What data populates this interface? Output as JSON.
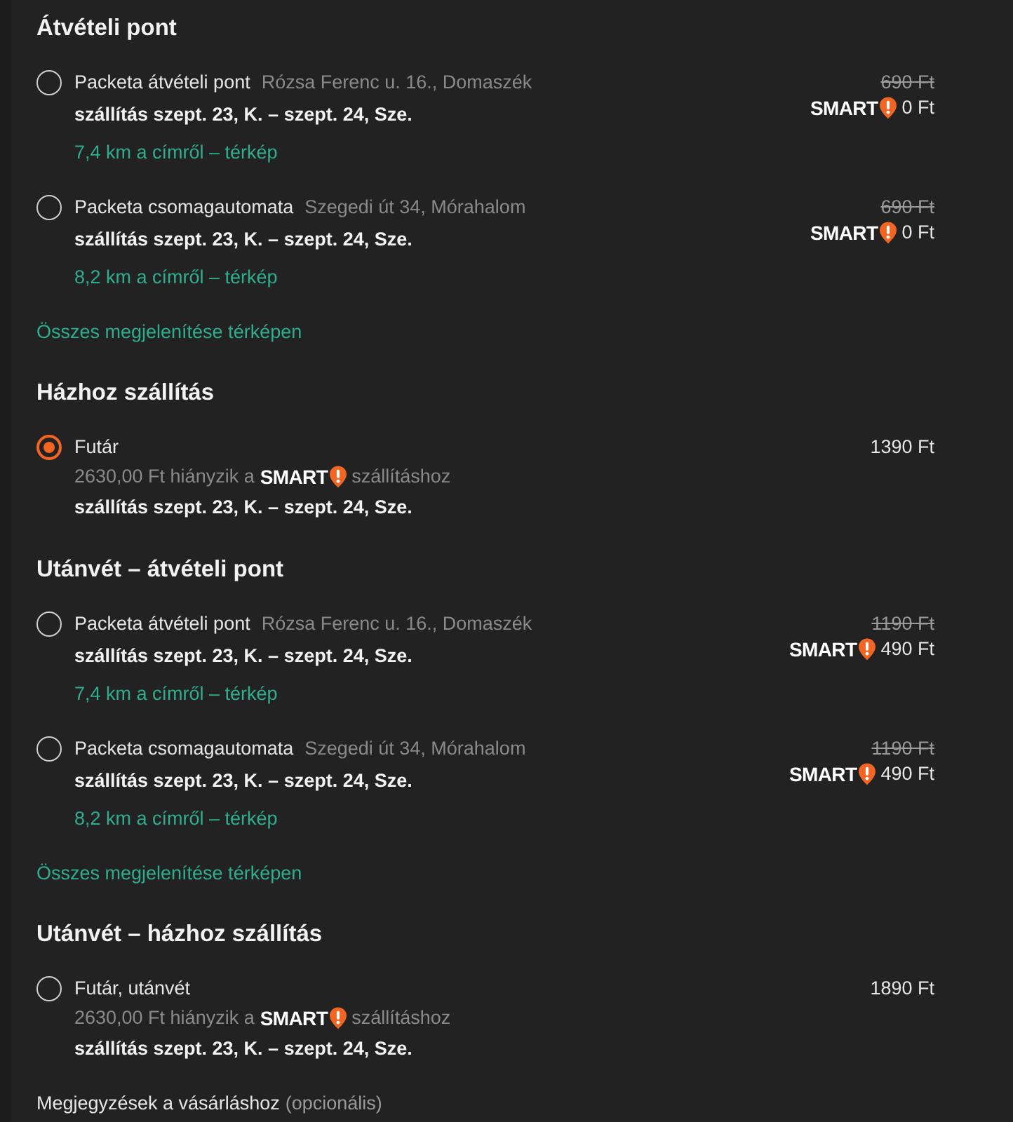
{
  "sections": [
    {
      "title": "Átvételi pont",
      "options": [
        {
          "name": "Packeta átvételi pont",
          "address": "Rózsa Ferenc u. 16., Domaszék",
          "selected": false,
          "delivery": "szállítás szept. 23, K. – szept. 24, Sze.",
          "distance": "7,4 km a címről – térkép",
          "old_price": "690 Ft",
          "smart_label": "SMART",
          "price": "0 Ft"
        },
        {
          "name": "Packeta csomagautomata",
          "address": "Szegedi út 34, Mórahalom",
          "selected": false,
          "delivery": "szállítás szept. 23, K. – szept. 24, Sze.",
          "distance": "8,2 km a címről – térkép",
          "old_price": "690 Ft",
          "smart_label": "SMART",
          "price": "0 Ft"
        }
      ],
      "map_link": "Összes megjelenítése térképen"
    },
    {
      "title": "Házhoz szállítás",
      "options": [
        {
          "name": "Futár",
          "selected": true,
          "note": {
            "before": "2630,00 Ft hiányzik a",
            "smart_label": "SMART",
            "after": "szállításhoz"
          },
          "delivery": "szállítás szept. 23, K. – szept. 24, Sze.",
          "price": "1390 Ft"
        }
      ]
    },
    {
      "title": "Utánvét – átvételi pont",
      "options": [
        {
          "name": "Packeta átvételi pont",
          "address": "Rózsa Ferenc u. 16., Domaszék",
          "selected": false,
          "delivery": "szállítás szept. 23, K. – szept. 24, Sze.",
          "distance": "7,4 km a címről – térkép",
          "old_price": "1190 Ft",
          "smart_label": "SMART",
          "price": "490 Ft"
        },
        {
          "name": "Packeta csomagautomata",
          "address": "Szegedi út 34, Mórahalom",
          "selected": false,
          "delivery": "szállítás szept. 23, K. – szept. 24, Sze.",
          "distance": "8,2 km a címről – térkép",
          "old_price": "1190 Ft",
          "smart_label": "SMART",
          "price": "490 Ft"
        }
      ],
      "map_link": "Összes megjelenítése térképen"
    },
    {
      "title": "Utánvét – házhoz szállítás",
      "options": [
        {
          "name": "Futár, utánvét",
          "selected": false,
          "note": {
            "before": "2630,00 Ft hiányzik a",
            "smart_label": "SMART",
            "after": "szállításhoz"
          },
          "delivery": "szállítás szept. 23, K. – szept. 24, Sze.",
          "price": "1890 Ft"
        }
      ]
    }
  ],
  "comment": {
    "label": "Megjegyzések a vásárláshoz",
    "hint": "(opcionális)"
  }
}
